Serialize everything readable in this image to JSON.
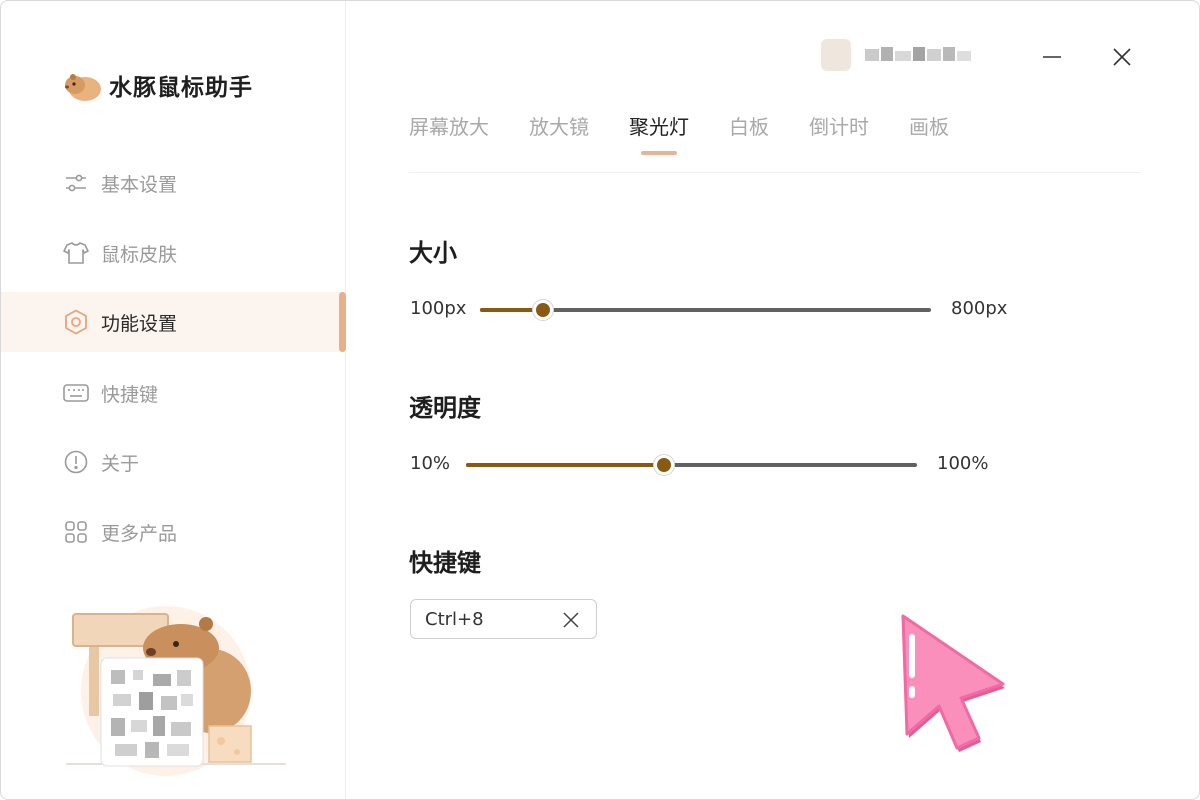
{
  "app": {
    "name": "水豚鼠标助手"
  },
  "sidebar": {
    "items": [
      {
        "label": "基本设置",
        "icon": "sliders-icon",
        "active": false
      },
      {
        "label": "鼠标皮肤",
        "icon": "shirt-icon",
        "active": false
      },
      {
        "label": "功能设置",
        "icon": "hexagon-gear-icon",
        "active": true
      },
      {
        "label": "快捷键",
        "icon": "keyboard-icon",
        "active": false
      },
      {
        "label": "关于",
        "icon": "info-circle-icon",
        "active": false
      },
      {
        "label": "更多产品",
        "icon": "grid-icon",
        "active": false
      }
    ]
  },
  "tabs": [
    {
      "label": "屏幕放大",
      "active": false
    },
    {
      "label": "放大镜",
      "active": false
    },
    {
      "label": "聚光灯",
      "active": true
    },
    {
      "label": "白板",
      "active": false
    },
    {
      "label": "倒计时",
      "active": false
    },
    {
      "label": "画板",
      "active": false
    }
  ],
  "settings": {
    "size": {
      "title": "大小",
      "min_label": "100px",
      "max_label": "800px",
      "value_fraction": 0.14
    },
    "opacity": {
      "title": "透明度",
      "min_label": "10%",
      "max_label": "100%",
      "value_fraction": 0.44
    },
    "hotkey": {
      "title": "快捷键",
      "value": "Ctrl+8"
    }
  },
  "colors": {
    "accent": "#e6b08a",
    "slider_fill": "#8a5a12",
    "slider_track": "#616161",
    "cursor_pink": "#f98ab4"
  }
}
